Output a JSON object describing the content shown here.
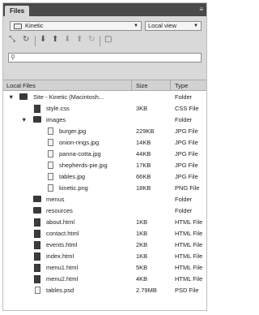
{
  "panel": {
    "tab_label": "Files",
    "menu_icon": "panel-menu-icon"
  },
  "toolbar": {
    "site_select": "Kinetic",
    "view_select": "Local view",
    "icons": [
      "connect-icon",
      "refresh-icon",
      "get-icon",
      "put-icon",
      "check-out-icon",
      "check-in-icon",
      "sync-icon",
      "expand-icon"
    ]
  },
  "search": {
    "placeholder": "",
    "value": ""
  },
  "columns": {
    "name": "Local Files",
    "size": "Size",
    "type": "Type"
  },
  "rows": [
    {
      "name": "Site - Kinetic (Macintosh...",
      "size": "",
      "type": "Folder"
    },
    {
      "name": "style.css",
      "size": "3KB",
      "type": "CSS File"
    },
    {
      "name": "images",
      "size": "",
      "type": "Folder"
    },
    {
      "name": "burger.jpg",
      "size": "229KB",
      "type": "JPG File"
    },
    {
      "name": "onion-rings.jpg",
      "size": "14KB",
      "type": "JPG File"
    },
    {
      "name": "panna-cotta.jpg",
      "size": "44KB",
      "type": "JPG File"
    },
    {
      "name": "shepherds-pie.jpg",
      "size": "17KB",
      "type": "JPG File"
    },
    {
      "name": "tables.jpg",
      "size": "66KB",
      "type": "JPG File"
    },
    {
      "name": "kinetic.png",
      "size": "18KB",
      "type": "PNG File"
    },
    {
      "name": "menus",
      "size": "",
      "type": "Folder"
    },
    {
      "name": "resources",
      "size": "",
      "type": "Folder"
    },
    {
      "name": "about.html",
      "size": "1KB",
      "type": "HTML File"
    },
    {
      "name": "contact.html",
      "size": "1KB",
      "type": "HTML File"
    },
    {
      "name": "events.html",
      "size": "2KB",
      "type": "HTML File"
    },
    {
      "name": "index.html",
      "size": "1KB",
      "type": "HTML File"
    },
    {
      "name": "menu1.html",
      "size": "5KB",
      "type": "HTML File"
    },
    {
      "name": "menu2.html",
      "size": "4KB",
      "type": "HTML File"
    },
    {
      "name": "tables.psd",
      "size": "2.79MB",
      "type": "PSD File"
    }
  ]
}
